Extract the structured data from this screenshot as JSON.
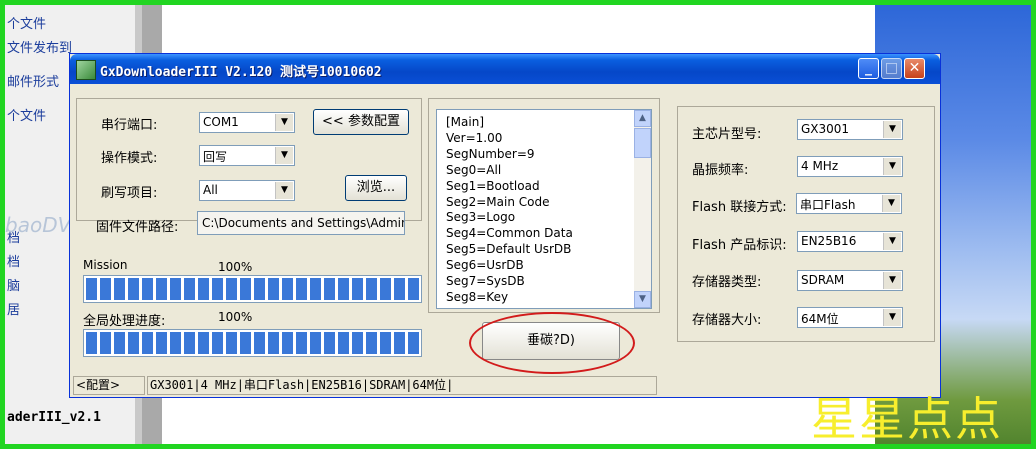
{
  "background": {
    "left_items": [
      "个文件",
      "文件发布到",
      "邮件形式",
      "个文件"
    ],
    "left_items_lower": [
      "档",
      "档",
      "脑",
      "居"
    ],
    "bottom_text": "aderIII_v2.1",
    "watermark": "baoDVV.net",
    "overlay_text": "星星点点"
  },
  "window": {
    "title": "GxDownloaderIII V2.120 测试号10010602"
  },
  "left_panel": {
    "serial_port_label": "串行端口:",
    "serial_port_value": "COM1",
    "config_button": "<< 参数配置",
    "mode_label": "操作模式:",
    "mode_value": "回写",
    "item_label": "刷写项目:",
    "item_value": "All",
    "browse_button": "浏览...",
    "path_label": "固件文件路径:",
    "path_value": "C:\\Documents and Settings\\Admin",
    "mission_label": "Mission",
    "mission_percent": "100%",
    "mission_progress": 1.0,
    "global_label": "全局处理进度:",
    "global_percent": "100%",
    "global_progress": 1.0
  },
  "ini_lines": [
    "[Main]",
    "Ver=1.00",
    "SegNumber=9",
    "Seg0=All",
    "Seg1=Bootload",
    "Seg2=Main Code",
    "Seg3=Logo",
    "Seg4=Common Data",
    "Seg5=Default UsrDB",
    "Seg6=UsrDB",
    "Seg7=SysDB",
    "Seg8=Key"
  ],
  "action_button": "垂碳?D)",
  "right_panel": {
    "chip_label": "主芯片型号:",
    "chip_value": "GX3001",
    "crystal_label": "晶振频率:",
    "crystal_value": "4 MHz",
    "flash_conn_label": "Flash 联接方式:",
    "flash_conn_value": "串口Flash",
    "flash_id_label": "Flash 产品标识:",
    "flash_id_value": "EN25B16",
    "mem_type_label": "存储器类型:",
    "mem_type_value": "SDRAM",
    "mem_size_label": "存储器大小:",
    "mem_size_value": "64M位"
  },
  "status": {
    "config_label": "<配置>",
    "summary": "GX3001|4 MHz|串口Flash|EN25B16|SDRAM|64M位|"
  }
}
